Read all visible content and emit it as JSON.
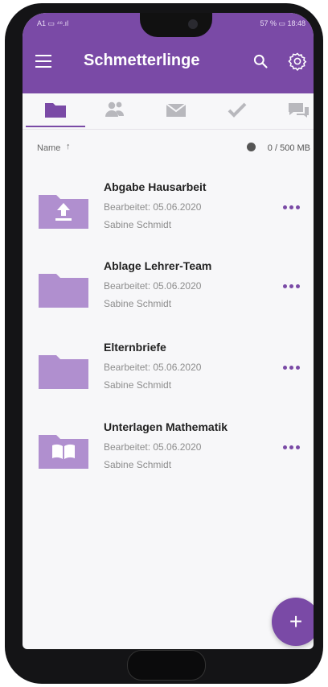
{
  "status": {
    "left": "A1 ▭ ⁴⁶.ıl",
    "right": "57 % ▭ 18:48"
  },
  "appbar": {
    "title": "Schmetterlinge"
  },
  "tabs": [
    {
      "icon": "folder-icon",
      "active": true
    },
    {
      "icon": "users-icon",
      "active": false
    },
    {
      "icon": "mail-icon",
      "active": false
    },
    {
      "icon": "check-icon",
      "active": false
    },
    {
      "icon": "chat-icon",
      "active": false
    }
  ],
  "sort": {
    "label": "Name",
    "arrow": "↑",
    "storage": "0 / 500 MB"
  },
  "items": [
    {
      "name": "Abgabe Hausarbeit",
      "edited": "Bearbeitet: 05.06.2020",
      "owner": "Sabine Schmidt",
      "icon": "upload-folder-icon"
    },
    {
      "name": "Ablage Lehrer-Team",
      "edited": "Bearbeitet: 05.06.2020",
      "owner": "Sabine Schmidt",
      "icon": "folder-icon"
    },
    {
      "name": "Elternbriefe",
      "edited": "Bearbeitet: 05.06.2020",
      "owner": "Sabine Schmidt",
      "icon": "folder-icon"
    },
    {
      "name": "Unterlagen Mathematik",
      "edited": "Bearbeitet: 05.06.2020",
      "owner": "Sabine Schmidt",
      "icon": "book-folder-icon"
    }
  ],
  "fab": {
    "label": "+"
  },
  "colors": {
    "accent": "#7a4aa6",
    "folder": "#b08fcf",
    "icon_gray": "#b8b8bd"
  }
}
